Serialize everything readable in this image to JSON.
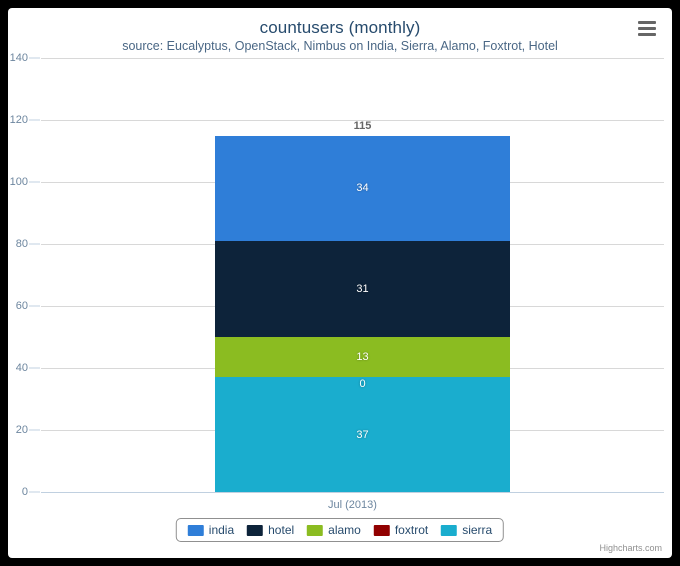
{
  "chart_data": {
    "type": "bar",
    "subtype": "stacked-column",
    "title": "countusers (monthly)",
    "subtitle": "source: Eucalyptus, OpenStack, Nimbus on India, Sierra, Alamo, Foxtrot, Hotel",
    "xlabel": "",
    "ylabel": "",
    "categories": [
      "Jul (2013)"
    ],
    "ylim": [
      0,
      140
    ],
    "ytick_step": 20,
    "yticks": [
      0,
      20,
      40,
      60,
      80,
      100,
      120,
      140
    ],
    "grid": true,
    "legend_position": "bottom",
    "stack_totals": [
      115
    ],
    "stack_order_bottom_to_top": [
      "sierra",
      "foxtrot",
      "alamo",
      "hotel",
      "india"
    ],
    "series": [
      {
        "name": "india",
        "values": [
          34
        ],
        "color": "#2f7ed8"
      },
      {
        "name": "hotel",
        "values": [
          31
        ],
        "color": "#0d233a"
      },
      {
        "name": "alamo",
        "values": [
          13
        ],
        "color": "#8bbc21"
      },
      {
        "name": "foxtrot",
        "values": [
          0
        ],
        "color": "#910000"
      },
      {
        "name": "sierra",
        "values": [
          37
        ],
        "color": "#1aadce"
      }
    ]
  },
  "labels": {
    "total_115": "115",
    "india_34": "34",
    "hotel_31": "31",
    "alamo_13": "13",
    "foxtrot_0": "0",
    "sierra_37": "37",
    "y_140": "140",
    "y_120": "120",
    "y_100": "100",
    "y_80": "80",
    "y_60": "60",
    "y_40": "40",
    "y_20": "20",
    "y_0": "0",
    "category_jul_2013": "Jul (2013)"
  },
  "legend": {
    "items": [
      {
        "label": "india",
        "color": "#2f7ed8"
      },
      {
        "label": "hotel",
        "color": "#0d233a"
      },
      {
        "label": "alamo",
        "color": "#8bbc21"
      },
      {
        "label": "foxtrot",
        "color": "#910000"
      },
      {
        "label": "sierra",
        "color": "#1aadce"
      }
    ]
  },
  "credits": "Highcharts.com",
  "export_menu": {
    "icon": "hamburger-menu-icon"
  },
  "colors": {
    "title": "#274b6d",
    "subtitle": "#4a6785",
    "axis_text": "#6d869f",
    "gridline": "#d8d8d8",
    "axis_line": "#c0d0e0",
    "total_label": "#666666",
    "credits": "#909090",
    "frame": "#000000",
    "plot_background": "#ffffff"
  }
}
